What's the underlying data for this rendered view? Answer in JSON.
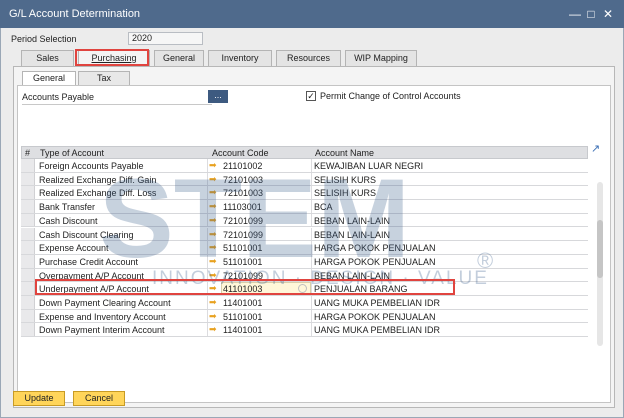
{
  "window": {
    "title": "G/L Account Determination"
  },
  "period": {
    "label": "Period Selection",
    "value": "2020"
  },
  "tabs": [
    {
      "label": "Sales"
    },
    {
      "label": "Purchasing"
    },
    {
      "label": "General"
    },
    {
      "label": "Inventory"
    },
    {
      "label": "Resources"
    },
    {
      "label": "WIP Mapping"
    }
  ],
  "subtabs": [
    {
      "label": "General"
    },
    {
      "label": "Tax"
    }
  ],
  "accounts_payable": {
    "label": "Accounts Payable",
    "button": "..."
  },
  "permit_change": {
    "label": "Permit Change of Control Accounts",
    "checked": true
  },
  "grid": {
    "columns": {
      "num": "#",
      "type": "Type of Account",
      "code": "Account Code",
      "name": "Account Name"
    },
    "rows": [
      {
        "type": "Foreign Accounts Payable",
        "code": "21101002",
        "name": "KEWAJIBAN LUAR NEGRI"
      },
      {
        "type": "Realized Exchange Diff. Gain",
        "code": "72101003",
        "name": "SELISIH KURS"
      },
      {
        "type": "Realized Exchange Diff. Loss",
        "code": "72101003",
        "name": "SELISIH KURS"
      },
      {
        "type": "Bank Transfer",
        "code": "11103001",
        "name": "BCA"
      },
      {
        "type": "Cash Discount",
        "code": "72101099",
        "name": "BEBAN LAIN-LAIN"
      },
      {
        "type": "Cash Discount Clearing",
        "code": "72101099",
        "name": "BEBAN LAIN-LAIN"
      },
      {
        "type": "Expense Account",
        "code": "51101001",
        "name": "HARGA POKOK PENJUALAN"
      },
      {
        "type": "Purchase Credit Account",
        "code": "51101001",
        "name": "HARGA POKOK PENJUALAN"
      },
      {
        "type": "Overpayment A/P Account",
        "code": "72101099",
        "name": "BEBAN LAIN-LAIN"
      },
      {
        "type": "Underpayment A/P Account",
        "code": "41101003",
        "name": "PENJUALAN BARANG"
      },
      {
        "type": "Down Payment Clearing Account",
        "code": "11401001",
        "name": "UANG MUKA PEMBELIAN IDR"
      },
      {
        "type": "Expense and Inventory Account",
        "code": "51101001",
        "name": "HARGA POKOK PENJUALAN"
      },
      {
        "type": "Down Payment Interim Account",
        "code": "11401001",
        "name": "UANG MUKA PEMBELIAN IDR"
      }
    ]
  },
  "watermark": {
    "letters": "STEM",
    "tagline": "INNOVATION · DESIGN · VALUE",
    "reg": "®"
  },
  "buttons": {
    "update": "Update",
    "cancel": "Cancel"
  },
  "colors": {
    "titlebar": "#4f6a8c",
    "highlight": "#e0443f",
    "button": "#ffd55a"
  }
}
